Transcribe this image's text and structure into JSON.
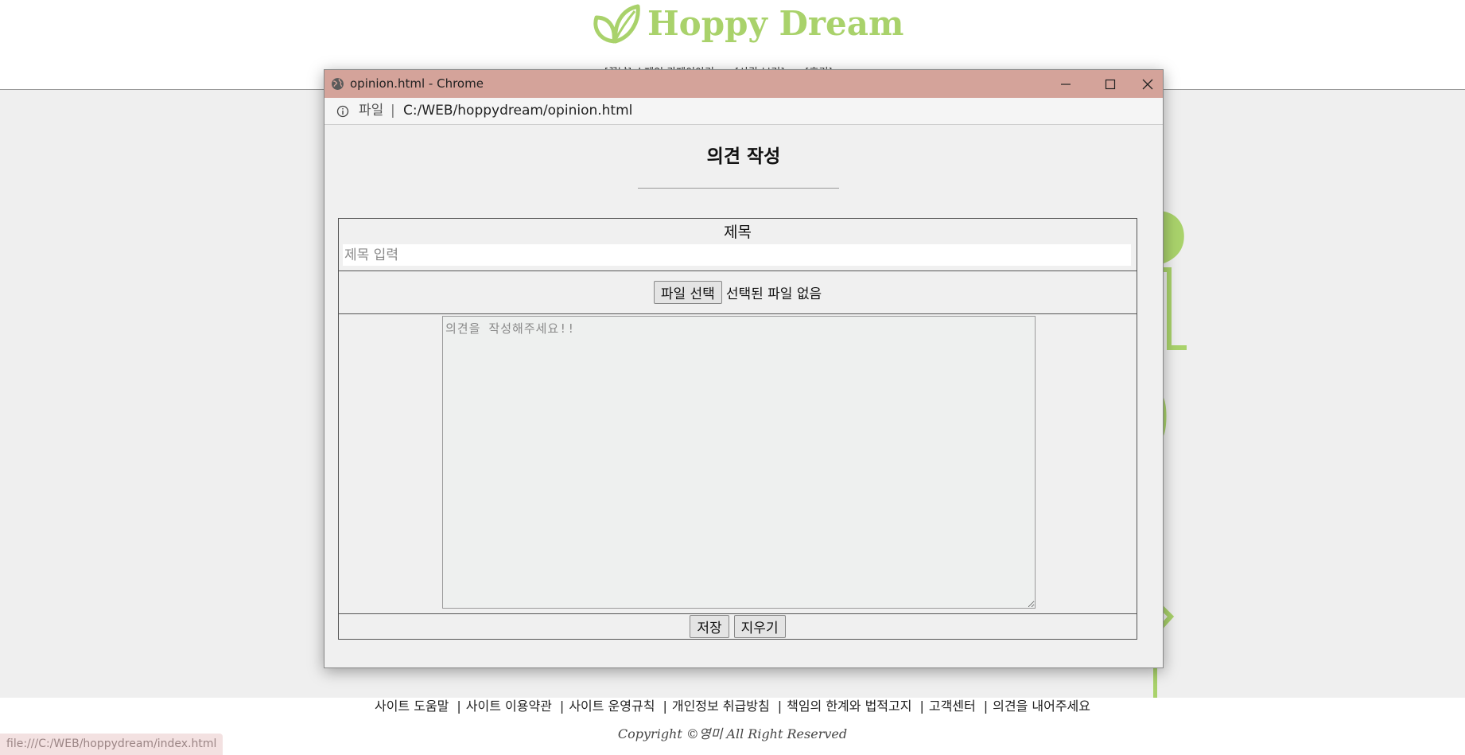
{
  "site": {
    "logo_text": "Hoppy Dream",
    "brand_color": "#a9d26b",
    "nav_items": [
      "[꽃남] 스페인 카페이야기",
      "[사랑 보기]",
      "[후기]"
    ]
  },
  "footer": {
    "links": [
      "사이트 도움말",
      "사이트 이용약관",
      "사이트 운영규칙",
      "개인정보 취급방침",
      "책임의 한계와 법적고지",
      "고객센터",
      "의견을 내어주세요"
    ],
    "copyright": "Copyright ©영미 All Right Reserved"
  },
  "status_bar": {
    "url": "file:///C:/WEB/hoppydream/index.html"
  },
  "popup": {
    "window_title": "opinion.html - Chrome",
    "titlebar_color": "#d4a39a",
    "address": {
      "scheme_label": "파일",
      "separator": "|",
      "url": "C:/WEB/hoppydream/opinion.html"
    },
    "page_title": "의견 작성",
    "form": {
      "subject_label": "제목",
      "subject_placeholder": "제목 입력",
      "subject_value": "",
      "file_button": "파일 선택",
      "file_status": "선택된 파일 없음",
      "opinion_placeholder": "의견을 작성해주세요!!",
      "opinion_value": "",
      "save_button": "저장",
      "clear_button": "지우기"
    }
  }
}
